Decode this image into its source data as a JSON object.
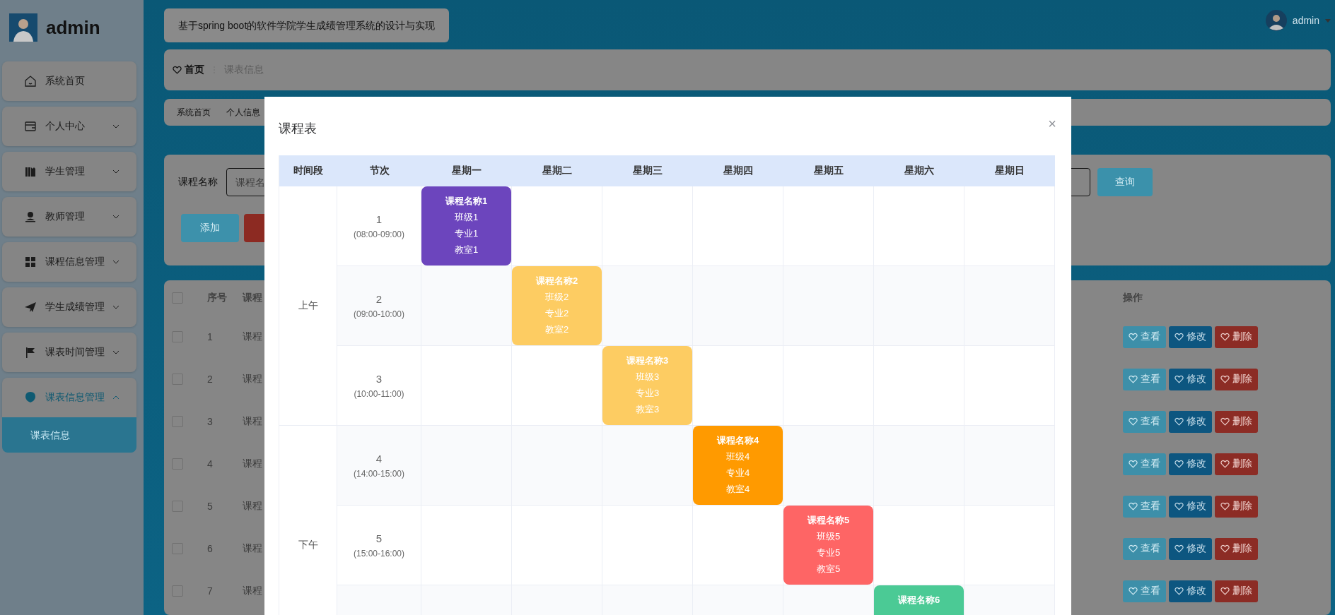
{
  "sidebar": {
    "user": "admin",
    "items": [
      {
        "label": "系统首页",
        "kind": "link",
        "expanded": false
      },
      {
        "label": "个人中心",
        "kind": "menu",
        "expanded": false
      },
      {
        "label": "学生管理",
        "kind": "menu",
        "expanded": false
      },
      {
        "label": "教师管理",
        "kind": "menu",
        "expanded": false
      },
      {
        "label": "课程信息管理",
        "kind": "menu",
        "expanded": false
      },
      {
        "label": "学生成绩管理",
        "kind": "menu",
        "expanded": false
      },
      {
        "label": "课表时间管理",
        "kind": "menu",
        "expanded": false
      },
      {
        "label": "课表信息管理",
        "kind": "menu",
        "expanded": true,
        "children": [
          {
            "label": "课表信息",
            "selected": true
          }
        ]
      }
    ]
  },
  "header": {
    "title": "基于spring boot的软件学院学生成绩管理系统的设计与实现",
    "user": "admin"
  },
  "breadcrumb": [
    {
      "label": "首页",
      "current": false
    },
    {
      "label": "课表信息",
      "current": true
    }
  ],
  "tabs": [
    {
      "label": "系统首页"
    },
    {
      "label": "个人信息"
    }
  ],
  "search": {
    "label": "课程名称",
    "placeholder": "课程名",
    "button": "查询",
    "actions": [
      {
        "kind": "add",
        "label": "添加"
      },
      {
        "kind": "delete"
      }
    ]
  },
  "table": {
    "columns": [
      "序号",
      "课程",
      "操作"
    ],
    "all_checked": false,
    "rows": [
      {
        "index": "1",
        "course": "课程",
        "checked": false,
        "actions": [
          "查看",
          "修改",
          "删除"
        ]
      },
      {
        "index": "2",
        "course": "课程",
        "checked": false,
        "actions": [
          "查看",
          "修改",
          "删除"
        ]
      },
      {
        "index": "3",
        "course": "课程",
        "checked": false,
        "actions": [
          "查看",
          "修改",
          "删除"
        ]
      },
      {
        "index": "4",
        "course": "课程",
        "checked": false,
        "actions": [
          "查看",
          "修改",
          "删除"
        ]
      },
      {
        "index": "5",
        "course": "课程",
        "checked": false,
        "actions": [
          "查看",
          "修改",
          "删除"
        ]
      },
      {
        "index": "6",
        "course": "课程",
        "checked": false,
        "actions": [
          "查看",
          "修改",
          "删除"
        ]
      },
      {
        "index": "7",
        "course": "课程",
        "checked": false,
        "actions": [
          "查看",
          "修改",
          "删除"
        ]
      }
    ]
  },
  "modal": {
    "title": "课程表",
    "close": "×",
    "columns": [
      "时间段",
      "节次",
      "星期一",
      "星期二",
      "星期三",
      "星期四",
      "星期五",
      "星期六",
      "星期日"
    ],
    "segments": [
      {
        "label": "上午",
        "rows": [
          {
            "period": "1",
            "time": "(08:00-09:00)",
            "cells": [
              {
                "kind": "course",
                "name": "课程名称1",
                "class": "班级1",
                "major": "专业1",
                "room": "教室1",
                "color": "#6c45bd"
              },
              {
                "kind": "empty"
              },
              {
                "kind": "empty"
              },
              {
                "kind": "empty"
              },
              {
                "kind": "empty"
              },
              {
                "kind": "empty"
              },
              {
                "kind": "empty"
              }
            ]
          },
          {
            "period": "2",
            "time": "(09:00-10:00)",
            "cells": [
              {
                "kind": "empty"
              },
              {
                "kind": "course",
                "name": "课程名称2",
                "class": "班级2",
                "major": "专业2",
                "room": "教室2",
                "color": "#fdcc62"
              },
              {
                "kind": "empty"
              },
              {
                "kind": "empty"
              },
              {
                "kind": "empty"
              },
              {
                "kind": "empty"
              },
              {
                "kind": "empty"
              }
            ]
          },
          {
            "period": "3",
            "time": "(10:00-11:00)",
            "cells": [
              {
                "kind": "empty"
              },
              {
                "kind": "empty"
              },
              {
                "kind": "course",
                "name": "课程名称3",
                "class": "班级3",
                "major": "专业3",
                "room": "教室3",
                "color": "#fdcc62"
              },
              {
                "kind": "empty"
              },
              {
                "kind": "empty"
              },
              {
                "kind": "empty"
              },
              {
                "kind": "empty"
              }
            ]
          }
        ]
      },
      {
        "label": "下午",
        "rows": [
          {
            "period": "4",
            "time": "(14:00-15:00)",
            "cells": [
              {
                "kind": "empty"
              },
              {
                "kind": "empty"
              },
              {
                "kind": "empty"
              },
              {
                "kind": "course",
                "name": "课程名称4",
                "class": "班级4",
                "major": "专业4",
                "room": "教室4",
                "color": "#ff9a00"
              },
              {
                "kind": "empty"
              },
              {
                "kind": "empty"
              },
              {
                "kind": "empty"
              }
            ]
          },
          {
            "period": "5",
            "time": "(15:00-16:00)",
            "cells": [
              {
                "kind": "empty"
              },
              {
                "kind": "empty"
              },
              {
                "kind": "empty"
              },
              {
                "kind": "empty"
              },
              {
                "kind": "course",
                "name": "课程名称5",
                "class": "班级5",
                "major": "专业5",
                "room": "教室5",
                "color": "#fe6565"
              },
              {
                "kind": "empty"
              },
              {
                "kind": "empty"
              }
            ]
          },
          {
            "cells": [
              {
                "kind": "empty"
              },
              {
                "kind": "empty"
              },
              {
                "kind": "empty"
              },
              {
                "kind": "empty"
              },
              {
                "kind": "empty"
              },
              {
                "kind": "course",
                "name": "课程名称6",
                "color": "#4bca95"
              },
              {
                "kind": "empty"
              }
            ]
          }
        ]
      }
    ]
  }
}
